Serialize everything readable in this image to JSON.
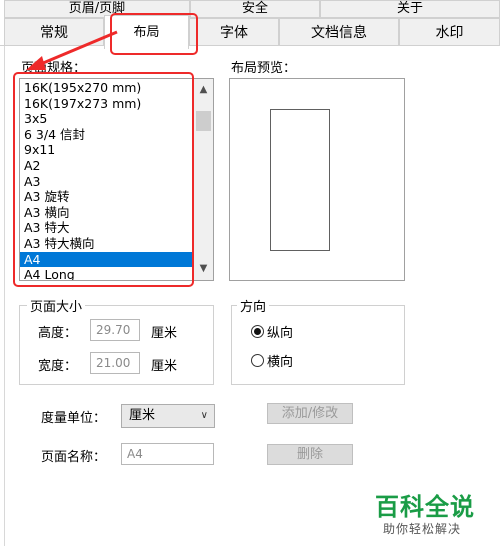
{
  "tabs_top": [
    "页眉/页脚",
    "安全",
    "关于"
  ],
  "tabs_main": [
    "常规",
    "布局",
    "字体",
    "文档信息",
    "水印"
  ],
  "page_size": {
    "label": "页面规格：",
    "items": [
      "16K(195x270 mm)",
      "16K(197x273 mm)",
      "3x5",
      "6 3/4 信封",
      "9x11",
      "A2",
      "A3",
      "A3 旋转",
      "A3 横向",
      "A3 特大",
      "A3 特大横向",
      "A4",
      "A4 Long"
    ],
    "selected": "A4",
    "scroll_up_icon": "▲",
    "scroll_down_icon": "▼"
  },
  "layout_preview": {
    "label": "布局预览："
  },
  "page_dimensions": {
    "title": "页面大小",
    "height_label": "高度：",
    "height_value": "29.70",
    "height_unit": "厘米",
    "width_label": "宽度：",
    "width_value": "21.00",
    "width_unit": "厘米"
  },
  "orientation": {
    "title": "方向",
    "portrait": "纵向",
    "landscape": "横向",
    "selected": "portrait"
  },
  "units": {
    "label": "度量单位：",
    "value": "厘米"
  },
  "page_name": {
    "label": "页面名称：",
    "value": "A4"
  },
  "buttons": {
    "add_modify": "添加/修改",
    "delete": "删除"
  },
  "watermark": {
    "main": "百科全说",
    "sub": "助你轻松解决"
  },
  "colors": {
    "highlight": "#ee2a2a",
    "selection": "#0078d7",
    "brand_green": "#1a9c46"
  }
}
